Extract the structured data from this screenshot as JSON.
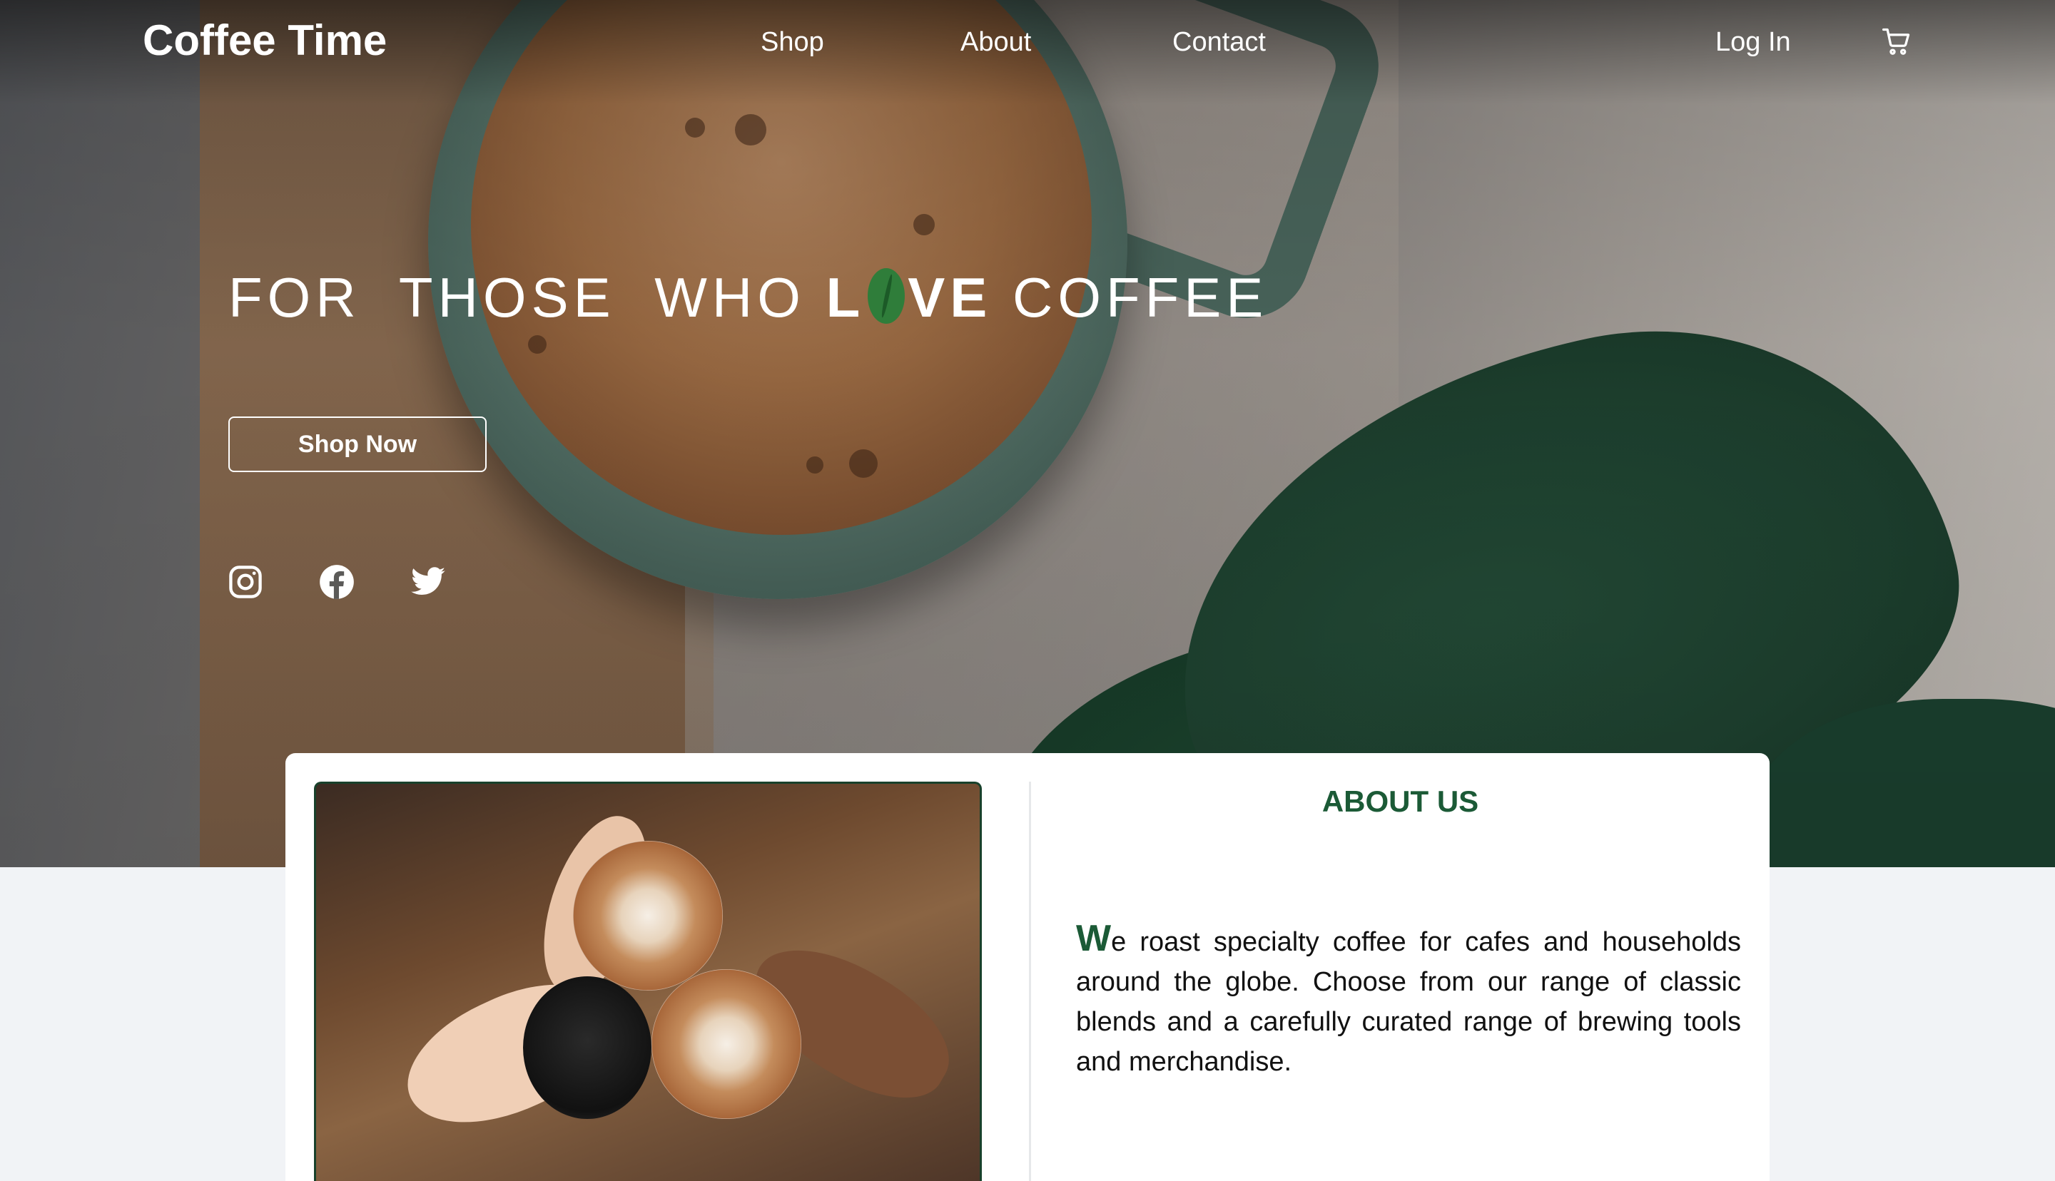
{
  "nav": {
    "brand": "Coffee Time",
    "links": [
      "Shop",
      "About",
      "Contact"
    ],
    "login": "Log In",
    "cart_icon": "cart-icon"
  },
  "hero": {
    "headline_word1": "FOR",
    "headline_word2": "THOSE",
    "headline_word3": "WHO",
    "love_l": "L",
    "love_ve": "VE",
    "headline_word4": "COFFEE",
    "love_o_icon": "coffee-bean-icon",
    "cta": "Shop Now",
    "social_icons": [
      "instagram-icon",
      "facebook-icon",
      "twitter-icon"
    ]
  },
  "about": {
    "title": "ABOUT US",
    "dropcap": "W",
    "text": "e roast specialty coffee for cafes and households around the globe. Choose from our range of classic blends and a carefully curated range of brewing tools and merchandise."
  },
  "colors": {
    "accent_green": "#1b5a36",
    "bean_green": "#2f7d3a",
    "page_bg": "#f1f3f6"
  }
}
